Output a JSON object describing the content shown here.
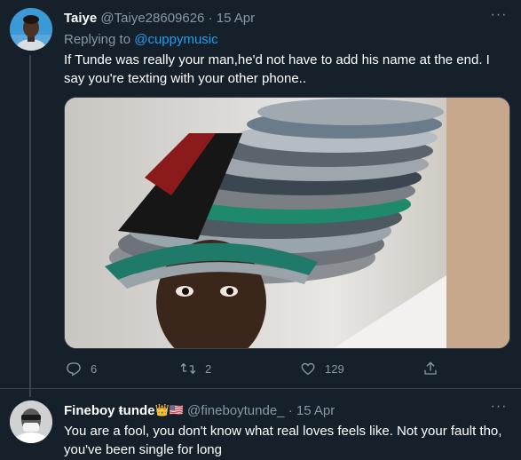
{
  "tweet1": {
    "display_name": "Taiye",
    "handle": "@Taiye28609626",
    "separator": "·",
    "date": "15 Apr",
    "more": "···",
    "replying_prefix": "Replying to",
    "replying_mention": "@cuppymusic",
    "text": "If Tunde was really your man,he'd not have to add his name at the end. I say you're texting with your other phone..",
    "replies": "6",
    "retweets": "2",
    "likes": "129"
  },
  "tweet2": {
    "display_name": "Fineboy ŧunde",
    "badges": "👑🇺🇸",
    "handle": "@fineboytunde_",
    "separator": "·",
    "date": "15 Apr",
    "more": "···",
    "text": "You are a fool, you don't know what real loves feels like. Not your fault tho, you've been single for long"
  },
  "colors": {
    "background": "#15202b",
    "muted": "#8899a6",
    "accent": "#1da1f2",
    "border": "#38444d"
  },
  "icons": [
    "reply-icon",
    "retweet-icon",
    "like-icon",
    "share-icon",
    "more-icon"
  ]
}
